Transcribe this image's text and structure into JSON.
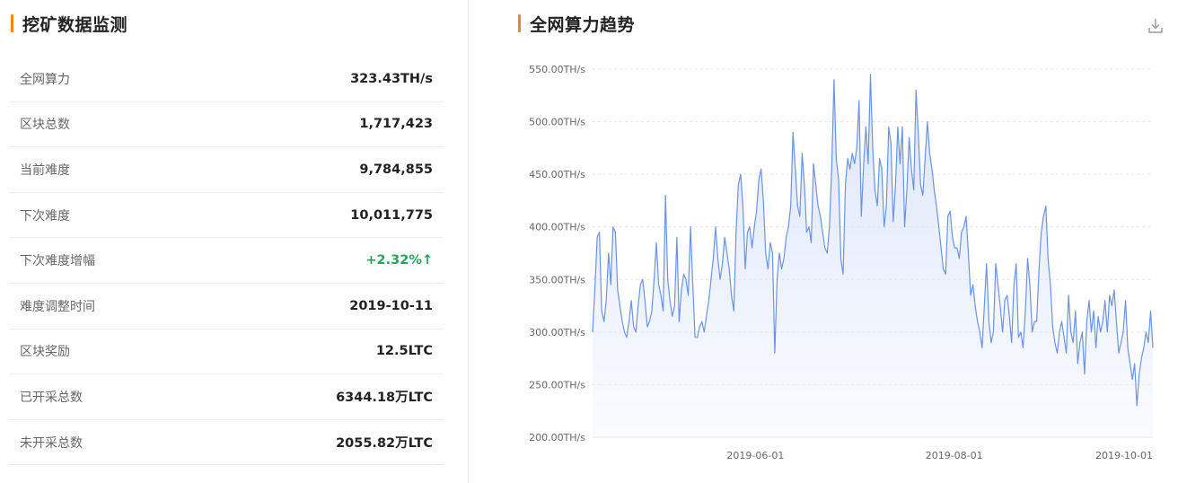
{
  "mining_panel": {
    "title": "挖矿数据监测",
    "stats": [
      {
        "label": "全网算力",
        "value": "323.43TH/s"
      },
      {
        "label": "区块总数",
        "value": "1,717,423"
      },
      {
        "label": "当前难度",
        "value": "9,784,855"
      },
      {
        "label": "下次难度",
        "value": "10,011,775"
      },
      {
        "label": "下次难度增幅",
        "value": "+2.32%↑"
      },
      {
        "label": "难度调整时间",
        "value": "2019-10-11"
      },
      {
        "label": "区块奖励",
        "value": "12.5LTC"
      },
      {
        "label": "已开采总数",
        "value": "6344.18万LTC"
      },
      {
        "label": "未开采总数",
        "value": "2055.82万LTC"
      }
    ]
  },
  "hashrate_panel": {
    "title": "全网算力趋势",
    "download_icon": "download-icon"
  },
  "colors": {
    "accent": "#f08519",
    "line": "#6a93e6",
    "area": "#dde6fb",
    "positive": "#27a35a"
  },
  "chart_data": {
    "type": "area",
    "title": "",
    "xlabel": "",
    "ylabel": "",
    "ylim": [
      200,
      550
    ],
    "y_ticks": [
      "550.00TH/s",
      "500.00TH/s",
      "450.00TH/s",
      "400.00TH/s",
      "350.00TH/s",
      "300.00TH/s",
      "250.00TH/s",
      "200.00TH/s"
    ],
    "x_ticks": [
      "2019-06-01",
      "2019-08-01",
      "2019-10-01"
    ],
    "x_range": [
      "2019-04-12",
      "2019-10-01"
    ],
    "grid": true,
    "legend": "none",
    "series": [
      {
        "values": [
          300,
          340,
          390,
          395,
          320,
          310,
          330,
          375,
          345,
          400,
          395,
          340,
          325,
          310,
          300,
          295,
          310,
          330,
          305,
          300,
          325,
          345,
          350,
          330,
          305,
          310,
          320,
          350,
          385,
          345,
          335,
          320,
          430,
          350,
          330,
          315,
          325,
          390,
          310,
          340,
          355,
          350,
          335,
          400,
          345,
          295,
          295,
          305,
          310,
          300,
          315,
          330,
          350,
          370,
          400,
          370,
          350,
          365,
          390,
          375,
          360,
          335,
          320,
          395,
          440,
          450,
          420,
          360,
          395,
          400,
          380,
          400,
          415,
          445,
          455,
          425,
          375,
          360,
          385,
          375,
          280,
          350,
          375,
          360,
          370,
          390,
          400,
          420,
          490,
          455,
          420,
          410,
          470,
          440,
          395,
          400,
          385,
          460,
          440,
          420,
          410,
          395,
          380,
          375,
          400,
          455,
          540,
          465,
          445,
          370,
          355,
          440,
          465,
          455,
          470,
          460,
          475,
          520,
          410,
          460,
          495,
          460,
          545,
          475,
          435,
          420,
          465,
          455,
          400,
          420,
          495,
          480,
          405,
          440,
          495,
          460,
          495,
          400,
          435,
          485,
          455,
          435,
          530,
          490,
          440,
          430,
          465,
          500,
          470,
          455,
          435,
          420,
          400,
          380,
          360,
          355,
          410,
          415,
          390,
          380,
          380,
          370,
          395,
          400,
          410,
          375,
          335,
          345,
          325,
          310,
          300,
          285,
          325,
          365,
          310,
          290,
          300,
          365,
          345,
          325,
          300,
          330,
          335,
          315,
          290,
          345,
          365,
          295,
          300,
          285,
          320,
          370,
          345,
          300,
          310,
          310,
          360,
          395,
          410,
          420,
          370,
          345,
          305,
          290,
          280,
          300,
          310,
          295,
          280,
          335,
          300,
          290,
          320,
          270,
          290,
          300,
          260,
          310,
          330,
          300,
          320,
          285,
          315,
          300,
          310,
          330,
          300,
          335,
          325,
          340,
          310,
          280,
          290,
          300,
          330,
          285,
          270,
          255,
          270,
          230,
          260,
          275,
          285,
          300,
          290,
          320,
          285
        ]
      }
    ]
  }
}
